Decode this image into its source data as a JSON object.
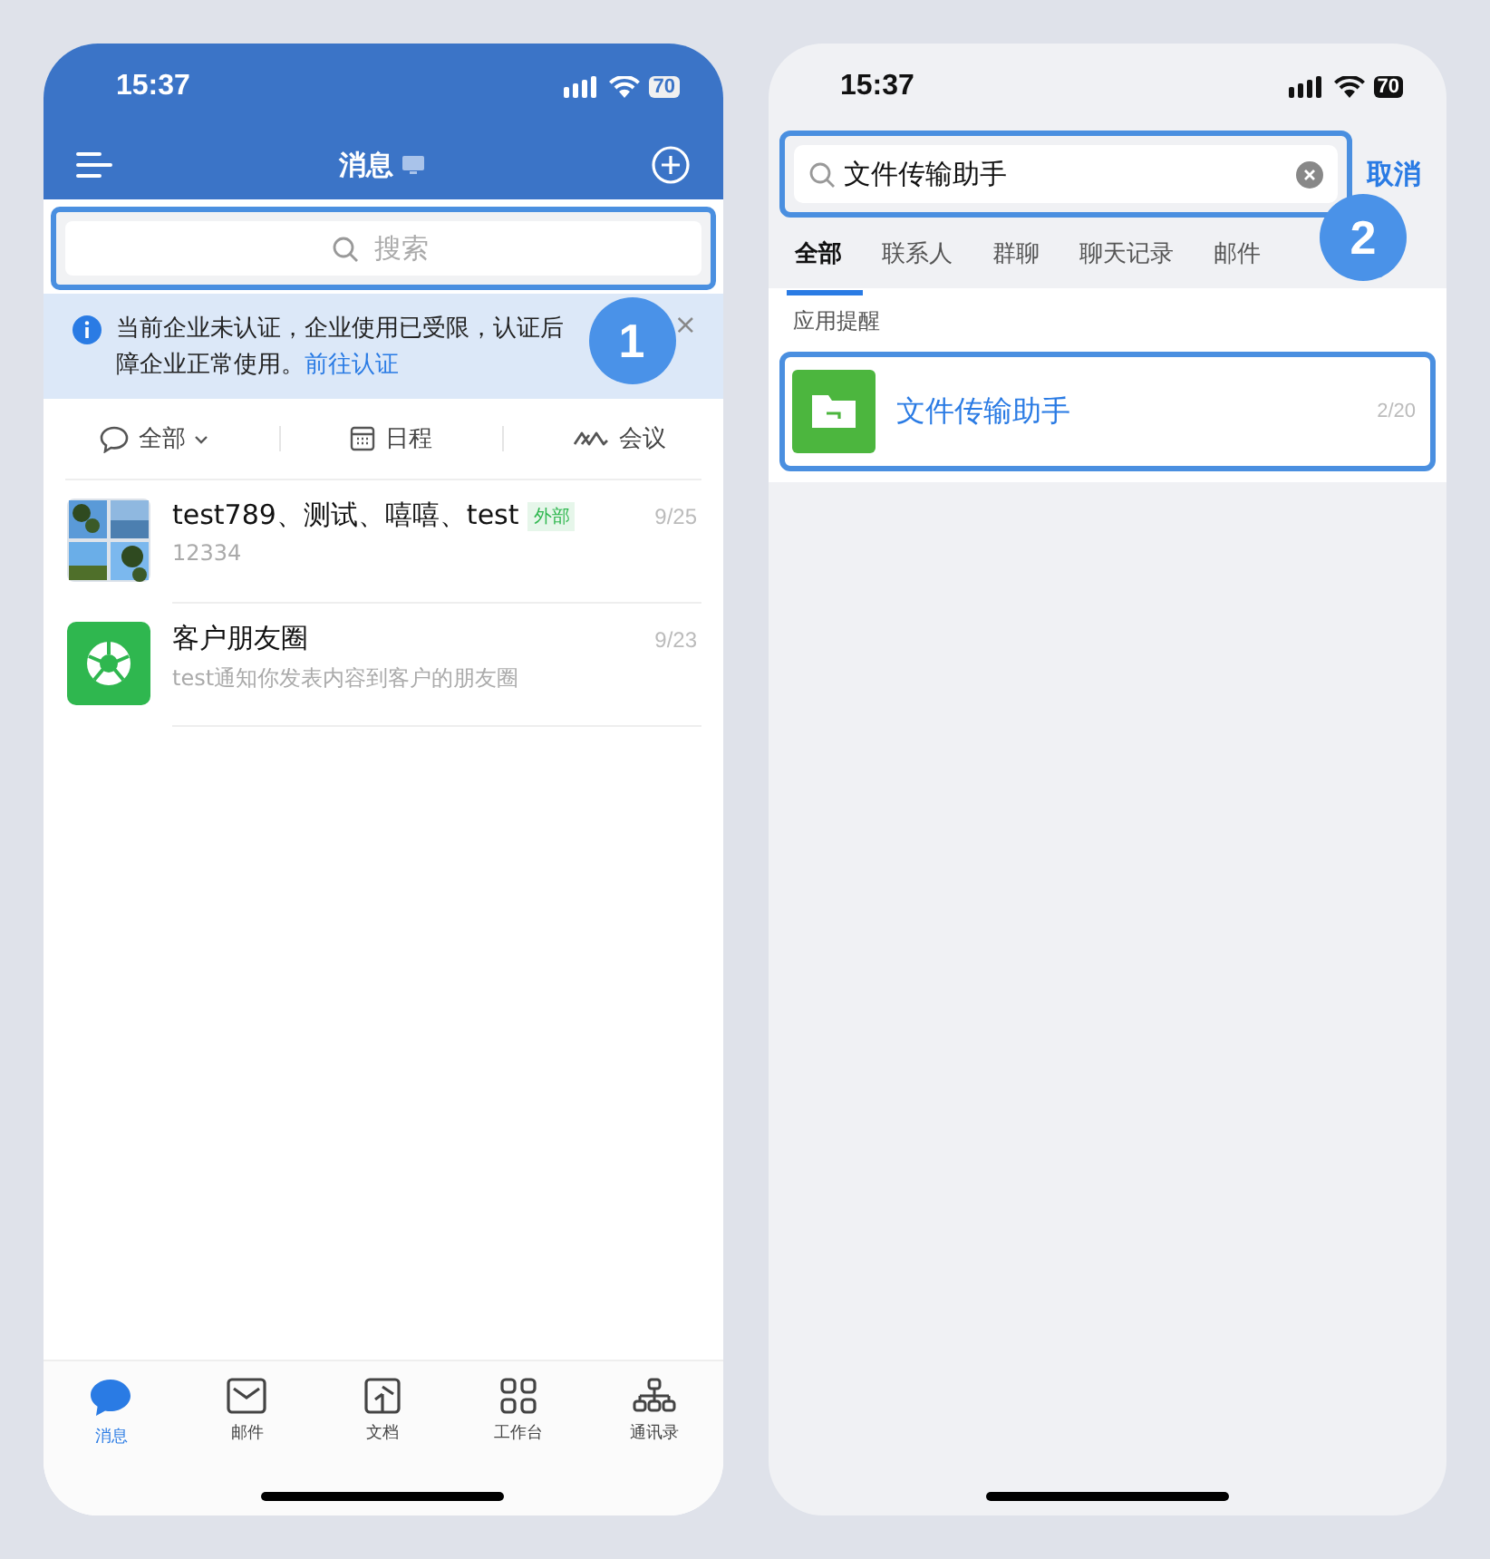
{
  "left": {
    "status_time": "15:37",
    "battery": "70",
    "title": "消息",
    "search": {
      "placeholder": "搜索"
    },
    "banner": {
      "line1": "当前企业未认证，企业使用已受限，认证后",
      "line2": "障企业正常使用。",
      "link": "前往认证",
      "close": "×"
    },
    "filters": [
      {
        "kind": "chat",
        "label": "全部"
      },
      {
        "kind": "calendar",
        "label": "日程"
      },
      {
        "kind": "meeting",
        "label": "会议"
      }
    ],
    "chats": [
      {
        "kind": "picture",
        "name": "test789、测试、嘻嘻、test",
        "tag": "外部",
        "preview": "12334",
        "date": "9/25"
      },
      {
        "kind": "moments",
        "name": "客户朋友圈",
        "preview": "test通知你发表内容到客户的朋友圈",
        "date": "9/23"
      }
    ],
    "tabbar": [
      {
        "kind": "chat",
        "label": "消息",
        "selected": true
      },
      {
        "kind": "mail",
        "label": "邮件",
        "selected": false
      },
      {
        "kind": "doc",
        "label": "文档",
        "selected": false
      },
      {
        "kind": "grid",
        "label": "工作台",
        "selected": false
      },
      {
        "kind": "org",
        "label": "通讯录",
        "selected": false
      }
    ],
    "step": "1"
  },
  "right": {
    "status_time": "15:37",
    "battery": "70",
    "search": {
      "value": "文件传输助手"
    },
    "cancel": "取消",
    "tabs": [
      {
        "label": "全部",
        "selected": true
      },
      {
        "label": "联系人",
        "selected": false
      },
      {
        "label": "群聊",
        "selected": false
      },
      {
        "label": "聊天记录",
        "selected": false
      },
      {
        "label": "邮件",
        "selected": false
      }
    ],
    "section": "应用提醒",
    "result": {
      "title": "文件传输助手",
      "count": "2/20"
    },
    "step": "2"
  }
}
